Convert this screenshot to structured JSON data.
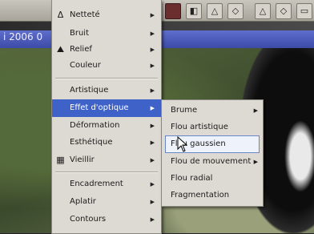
{
  "background": {
    "date_text": "i 2006 0"
  },
  "menu": {
    "items": [
      {
        "label": "Netteté",
        "has_submenu": true,
        "icon": "delta-icon"
      },
      {
        "label": "Bruit",
        "has_submenu": true
      },
      {
        "label": "Relief",
        "has_submenu": true,
        "icon": "relief-icon"
      },
      {
        "label": "Couleur",
        "has_submenu": true
      },
      {
        "label": "Artistique",
        "has_submenu": true
      },
      {
        "label": "Effet d'optique",
        "has_submenu": true,
        "highlighted": true
      },
      {
        "label": "Déformation",
        "has_submenu": true
      },
      {
        "label": "Esthétique",
        "has_submenu": true
      },
      {
        "label": "Vieillir",
        "has_submenu": true,
        "icon": "film-icon"
      },
      {
        "label": "Encadrement",
        "has_submenu": true
      },
      {
        "label": "Aplatir",
        "has_submenu": true
      },
      {
        "label": "Contours",
        "has_submenu": true
      }
    ]
  },
  "submenu": {
    "items": [
      {
        "label": "Brume",
        "has_submenu": true
      },
      {
        "label": "Flou artistique"
      },
      {
        "label": "Flou gaussien",
        "selected": true
      },
      {
        "label": "Flou de mouvement",
        "has_submenu": true
      },
      {
        "label": "Flou radial"
      },
      {
        "label": "Fragmentation"
      }
    ]
  },
  "colors": {
    "highlight": "#3f62c9",
    "menu_bg": "#dcdad3"
  }
}
